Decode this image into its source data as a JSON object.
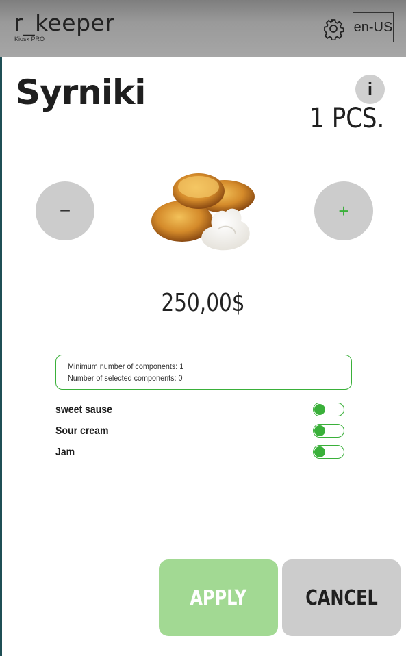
{
  "header": {
    "brand": "r_keeper",
    "brand_sub": "Kiosk PRO",
    "settings_icon": "gear-icon",
    "language": "en-US"
  },
  "product": {
    "title": "Syrniki",
    "info_label": "i",
    "quantity": "1 PCS.",
    "minus_label": "−",
    "plus_label": "+",
    "price": "250,00$"
  },
  "components": {
    "min_text": "Minimum number of components: 1",
    "selected_text": "Number of selected components: 0",
    "options": [
      {
        "label": "sweet sause",
        "on": false
      },
      {
        "label": "Sour cream",
        "on": false
      },
      {
        "label": "Jam",
        "on": false
      }
    ]
  },
  "actions": {
    "apply": "APPLY",
    "cancel": "CANCEL"
  },
  "colors": {
    "accent_green": "#3ab03a",
    "apply_bg": "#a2d993",
    "neutral_button": "#cccccc"
  }
}
